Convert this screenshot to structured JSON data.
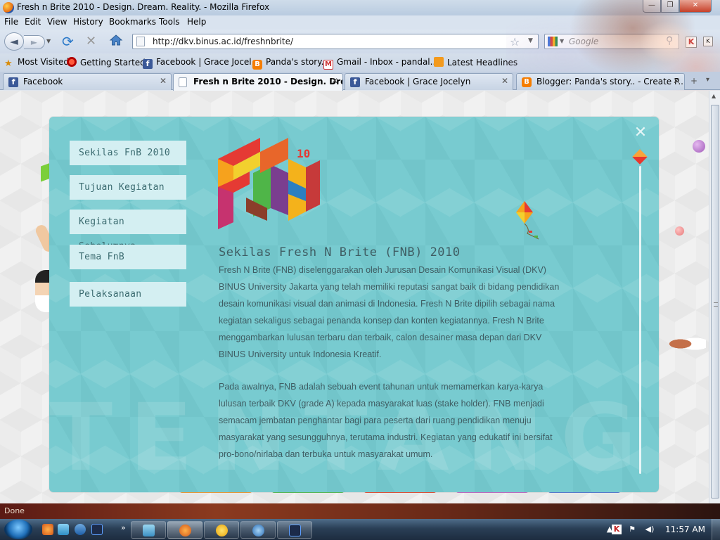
{
  "window": {
    "title": "Fresh n Brite 2010 - Design. Dream. Reality. - Mozilla Firefox",
    "minimize_glyph": "—",
    "maximize_glyph": "❐",
    "close_glyph": "✕"
  },
  "menubar": {
    "items": [
      "File",
      "Edit",
      "View",
      "History",
      "Bookmarks",
      "Tools",
      "Help"
    ]
  },
  "navbar": {
    "back_glyph": "◄",
    "forward_glyph": "►",
    "history_glyph": "▼",
    "reload_glyph": "⟳",
    "stop_glyph": "✕",
    "url": "http://dkv.binus.ac.id/freshnbrite/",
    "bookmark_star": "☆",
    "url_dropdown": "▼",
    "search_placeholder": "Google",
    "search_dropdown": "▼",
    "search_button": "⚲",
    "addon1_letter": "K",
    "addon2_letter": "K"
  },
  "bookmarks": {
    "items": [
      {
        "label": "Most Visited",
        "icon": "most-visited-icon"
      },
      {
        "label": "Getting Started",
        "icon": "firefox-icon"
      },
      {
        "label": "Facebook | Grace Jocel...",
        "icon": "facebook-icon"
      },
      {
        "label": "Panda's story..",
        "icon": "blogger-icon"
      },
      {
        "label": "Gmail - Inbox - pandal...",
        "icon": "gmail-icon"
      },
      {
        "label": "Latest Headlines",
        "icon": "rss-icon"
      }
    ],
    "facebook_letter": "f",
    "blogger_letter": "B",
    "gmail_letter": "M",
    "star_glyph": "★"
  },
  "tabs": {
    "items": [
      {
        "label": "Facebook",
        "icon": "facebook-icon",
        "active": false
      },
      {
        "label": "Fresh n Brite 2010 - Design. Dre...",
        "icon": "page-icon",
        "active": true
      },
      {
        "label": "Facebook | Grace Jocelyn",
        "icon": "facebook-icon",
        "active": false
      },
      {
        "label": "Blogger: Panda's story.. - Create P...",
        "icon": "blogger-icon",
        "active": false
      }
    ],
    "close_glyph": "✕",
    "list_glyph": "▾",
    "new_glyph": "+"
  },
  "page": {
    "sidebar": [
      "Sekilas FnB 2010",
      "Tujuan Kegiatan",
      "Kegiatan Sebelumnya",
      "Tema FnB",
      "Pelaksanaan"
    ],
    "panel_close_glyph": "✕",
    "watermark": "TENTANG FNB",
    "heading": "Sekilas Fresh N Brite (FNB) 2010",
    "para1": "Fresh N Brite (FNB) diselenggarakan oleh Jurusan Desain Komunikasi Visual (DKV) BINUS University Jakarta yang telah memiliki reputasi sangat baik di bidang pendidikan desain komunikasi visual dan animasi di Indonesia. Fresh N Brite dipilih sebagai nama kegiatan sekaligus sebagai penanda konsep dan konten kegiatannya. Fresh N Brite menggambarkan lulusan terbaru dan terbaik, calon desainer masa depan dari DKV BINUS University untuk Indonesia Kreatif.",
    "para2": "Pada awalnya, FNB adalah sebuah event tahunan untuk memamerkan karya-karya lulusan terbaik DKV (grade A) kepada masyarakat luas (stake holder). FNB menjadi semacam jembatan penghantar bagi para peserta dari ruang pendidikan menuju masyarakat yang sesungguhnya, terutama industri. Kegiatan yang edukatif ini bersifat pro-bono/nirlaba dan terbuka untuk masyarakat umum.",
    "category_colors": [
      "#f3a03a",
      "#5cc05a",
      "#e8543a",
      "#c46fc9",
      "#5a7fd6"
    ]
  },
  "statusbar": {
    "text": "Done"
  },
  "taskbar": {
    "chevron": "»",
    "clock": "11:57 AM",
    "tray_up": "▲",
    "tray_flag": "⚑",
    "tray_volume": "◀)"
  },
  "colors": {
    "panel": "#78cbd0",
    "sidebar_button": "#d4eff2",
    "content_text": "#3f5d63"
  }
}
